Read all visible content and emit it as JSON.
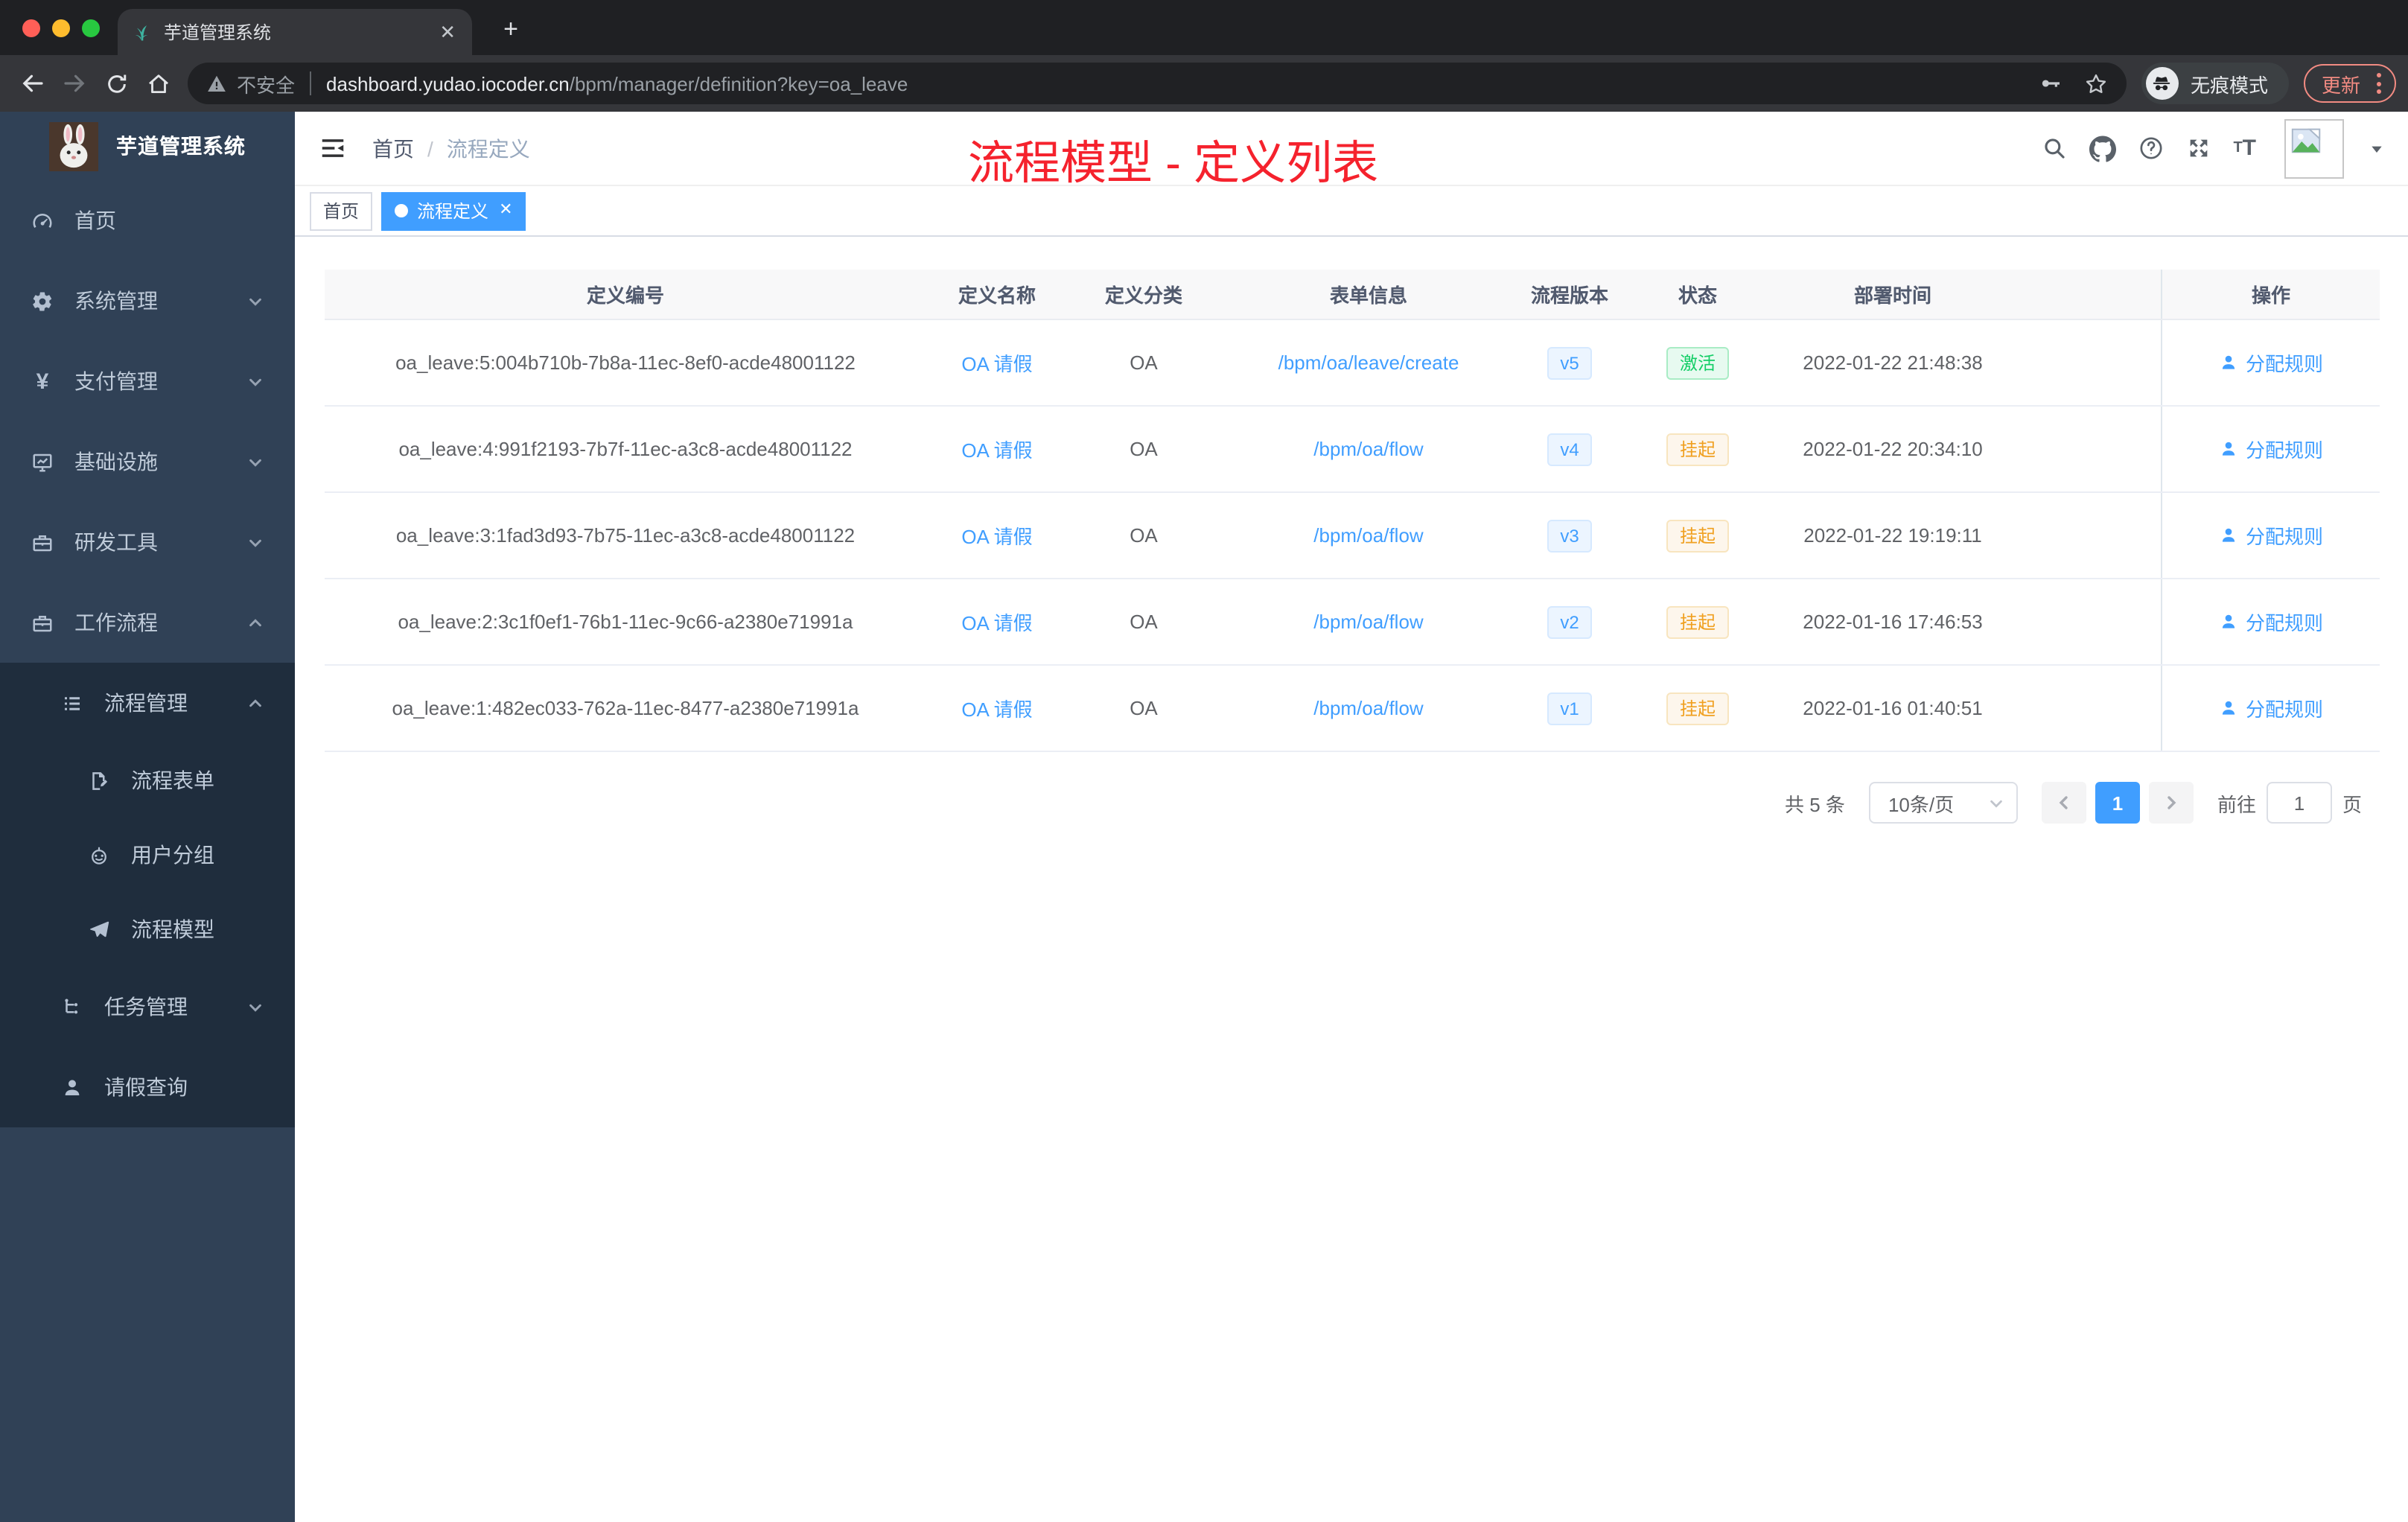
{
  "browser": {
    "tab_title": "芋道管理系统",
    "security_label": "不安全",
    "url_host": "dashboard.yudao.iocoder.cn",
    "url_path": "/bpm/manager/definition?key=oa_leave",
    "incognito_label": "无痕模式",
    "update_label": "更新"
  },
  "sidebar": {
    "title": "芋道管理系统",
    "items": [
      {
        "label": "首页",
        "icon": "dashboard-icon",
        "level": 1
      },
      {
        "label": "系统管理",
        "icon": "gear-icon",
        "level": 1,
        "arrow": "down"
      },
      {
        "label": "支付管理",
        "icon": "yen-icon",
        "level": 1,
        "arrow": "down"
      },
      {
        "label": "基础设施",
        "icon": "monitor-icon",
        "level": 1,
        "arrow": "down"
      },
      {
        "label": "研发工具",
        "icon": "toolbox-icon",
        "level": 1,
        "arrow": "down"
      },
      {
        "label": "工作流程",
        "icon": "briefcase-icon",
        "level": 1,
        "arrow": "up"
      },
      {
        "label": "流程管理",
        "icon": "list-icon",
        "level": 2,
        "arrow": "up",
        "dark": true
      },
      {
        "label": "流程表单",
        "icon": "form-icon",
        "level": 3,
        "dark": true
      },
      {
        "label": "用户分组",
        "icon": "robot-icon",
        "level": 3,
        "dark": true
      },
      {
        "label": "流程模型",
        "icon": "paper-plane-icon",
        "level": 3,
        "dark": true
      },
      {
        "label": "任务管理",
        "icon": "tree-icon",
        "level": 2,
        "arrow": "down",
        "dark": true
      },
      {
        "label": "请假查询",
        "icon": "user-icon",
        "level": 2,
        "dark": true
      }
    ]
  },
  "navbar": {
    "breadcrumb_home": "首页",
    "breadcrumb_current": "流程定义"
  },
  "tags": [
    {
      "label": "首页",
      "active": false,
      "closable": false
    },
    {
      "label": "流程定义",
      "active": true,
      "closable": true
    }
  ],
  "annotation": {
    "text": "流程模型 - 定义列表"
  },
  "table": {
    "columns": [
      "定义编号",
      "定义名称",
      "定义分类",
      "表单信息",
      "流程版本",
      "状态",
      "部署时间",
      "操作"
    ],
    "action_label": "分配规则",
    "rows": [
      {
        "id": "oa_leave:5:004b710b-7b8a-11ec-8ef0-acde48001122",
        "name": "OA 请假",
        "category": "OA",
        "form": "/bpm/oa/leave/create",
        "version": "v5",
        "status": "激活",
        "status_type": "success",
        "deployed": "2022-01-22 21:48:38"
      },
      {
        "id": "oa_leave:4:991f2193-7b7f-11ec-a3c8-acde48001122",
        "name": "OA 请假",
        "category": "OA",
        "form": "/bpm/oa/flow",
        "version": "v4",
        "status": "挂起",
        "status_type": "warning",
        "deployed": "2022-01-22 20:34:10"
      },
      {
        "id": "oa_leave:3:1fad3d93-7b75-11ec-a3c8-acde48001122",
        "name": "OA 请假",
        "category": "OA",
        "form": "/bpm/oa/flow",
        "version": "v3",
        "status": "挂起",
        "status_type": "warning",
        "deployed": "2022-01-22 19:19:11"
      },
      {
        "id": "oa_leave:2:3c1f0ef1-76b1-11ec-9c66-a2380e71991a",
        "name": "OA 请假",
        "category": "OA",
        "form": "/bpm/oa/flow",
        "version": "v2",
        "status": "挂起",
        "status_type": "warning",
        "deployed": "2022-01-16 17:46:53"
      },
      {
        "id": "oa_leave:1:482ec033-762a-11ec-8477-a2380e71991a",
        "name": "OA 请假",
        "category": "OA",
        "form": "/bpm/oa/flow",
        "version": "v1",
        "status": "挂起",
        "status_type": "warning",
        "deployed": "2022-01-16 01:40:51"
      }
    ]
  },
  "pagination": {
    "total_label": "共 5 条",
    "page_size": "10条/页",
    "current_page": "1",
    "goto_label": "前往",
    "goto_value": "1",
    "page_unit": "页"
  },
  "colors": {
    "accent": "#409eff",
    "success": "#13ce66",
    "warning": "#f0a020",
    "annotation_red": "#f5222d",
    "sidebar_bg": "#304156",
    "submenu_bg": "#1f2d3d"
  }
}
